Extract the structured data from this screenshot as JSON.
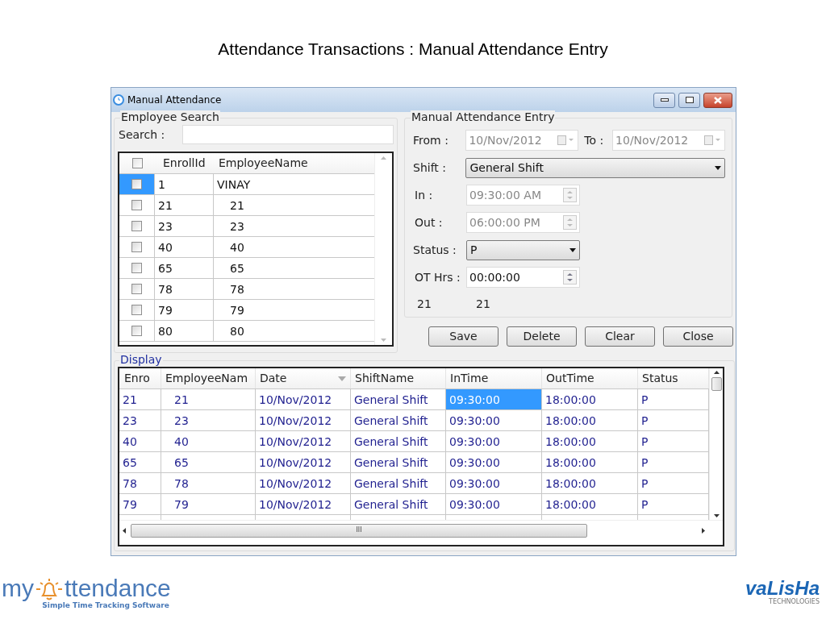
{
  "slide_title": "Attendance Transactions : Manual Attendance Entry",
  "window": {
    "title": "Manual Attendance"
  },
  "employee_search": {
    "legend": "Employee Search",
    "search_label": "Search :",
    "columns": [
      "EnrollId",
      "EmployeeName"
    ],
    "header_checked": false,
    "rows": [
      {
        "enroll": "1",
        "name": "VINAY",
        "checked": false,
        "selected": true
      },
      {
        "enroll": "21",
        "name": "21",
        "checked": false,
        "selected": false
      },
      {
        "enroll": "23",
        "name": "23",
        "checked": false,
        "selected": false
      },
      {
        "enroll": "40",
        "name": "40",
        "checked": false,
        "selected": false
      },
      {
        "enroll": "65",
        "name": "65",
        "checked": false,
        "selected": false
      },
      {
        "enroll": "78",
        "name": "78",
        "checked": false,
        "selected": false
      },
      {
        "enroll": "79",
        "name": "79",
        "checked": false,
        "selected": false
      },
      {
        "enroll": "80",
        "name": "80",
        "checked": false,
        "selected": false
      }
    ]
  },
  "entry": {
    "legend": "Manual Attendance Entry",
    "from_label": "From :",
    "from_value": "10/Nov/2012",
    "to_label": "To :",
    "to_value": "10/Nov/2012",
    "shift_label": "Shift :",
    "shift_value": "General Shift",
    "in_label": "In :",
    "in_value": "09:30:00 AM",
    "in_disabled": true,
    "out_label": "Out :",
    "out_value": "06:00:00 PM",
    "out_disabled": true,
    "status_label": "Status :",
    "status_value": "P",
    "ot_label": "OT Hrs :",
    "ot_value": "00:00:00",
    "ot_disabled": false,
    "info": [
      "21",
      "21"
    ]
  },
  "buttons": [
    "Save",
    "Delete",
    "Clear",
    "Close"
  ],
  "display": {
    "legend": "Display",
    "columns": [
      "Enro",
      "EmployeeNam",
      "Date",
      "ShiftName",
      "InTime",
      "OutTime",
      "Status"
    ],
    "rows": [
      [
        {
          "text": "21",
          "selected": false
        },
        {
          "text": "21",
          "selected": false
        },
        {
          "text": "10/Nov/2012",
          "selected": false
        },
        {
          "text": "General Shift",
          "selected": false
        },
        {
          "text": "09:30:00",
          "selected": true
        },
        {
          "text": "18:00:00",
          "selected": false
        },
        {
          "text": "P",
          "selected": false
        }
      ],
      [
        {
          "text": "23",
          "selected": false
        },
        {
          "text": "23",
          "selected": false
        },
        {
          "text": "10/Nov/2012",
          "selected": false
        },
        {
          "text": "General Shift",
          "selected": false
        },
        {
          "text": "09:30:00",
          "selected": false
        },
        {
          "text": "18:00:00",
          "selected": false
        },
        {
          "text": "P",
          "selected": false
        }
      ],
      [
        {
          "text": "40",
          "selected": false
        },
        {
          "text": "40",
          "selected": false
        },
        {
          "text": "10/Nov/2012",
          "selected": false
        },
        {
          "text": "General Shift",
          "selected": false
        },
        {
          "text": "09:30:00",
          "selected": false
        },
        {
          "text": "18:00:00",
          "selected": false
        },
        {
          "text": "P",
          "selected": false
        }
      ],
      [
        {
          "text": "65",
          "selected": false
        },
        {
          "text": "65",
          "selected": false
        },
        {
          "text": "10/Nov/2012",
          "selected": false
        },
        {
          "text": "General Shift",
          "selected": false
        },
        {
          "text": "09:30:00",
          "selected": false
        },
        {
          "text": "18:00:00",
          "selected": false
        },
        {
          "text": "P",
          "selected": false
        }
      ],
      [
        {
          "text": "78",
          "selected": false
        },
        {
          "text": "78",
          "selected": false
        },
        {
          "text": "10/Nov/2012",
          "selected": false
        },
        {
          "text": "General Shift",
          "selected": false
        },
        {
          "text": "09:30:00",
          "selected": false
        },
        {
          "text": "18:00:00",
          "selected": false
        },
        {
          "text": "P",
          "selected": false
        }
      ],
      [
        {
          "text": "79",
          "selected": false
        },
        {
          "text": "79",
          "selected": false
        },
        {
          "text": "10/Nov/2012",
          "selected": false
        },
        {
          "text": "General Shift",
          "selected": false
        },
        {
          "text": "09:30:00",
          "selected": false
        },
        {
          "text": "18:00:00",
          "selected": false
        },
        {
          "text": "P",
          "selected": false
        }
      ]
    ],
    "hscroll_mark": "III"
  },
  "logo_left": {
    "name_start": "my",
    "name_end": "ttendance",
    "tagline": "Simple Time Tracking Software"
  },
  "logo_right": {
    "name": "vaLisHa",
    "tagline": "TECHNOLOGIES"
  }
}
